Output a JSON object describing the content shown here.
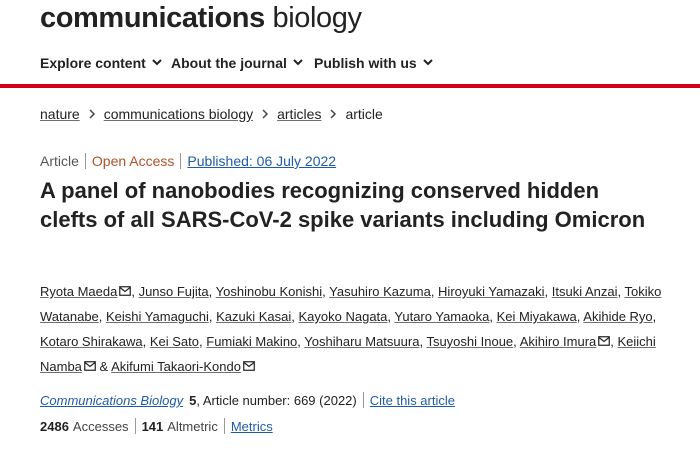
{
  "header": {
    "brand_bold": "communications",
    "brand_light": "biology"
  },
  "nav": {
    "items": [
      {
        "label": "Explore content"
      },
      {
        "label": "About the journal"
      },
      {
        "label": "Publish with us"
      }
    ],
    "accent_color": "#d0021b"
  },
  "breadcrumb": {
    "items": [
      "nature",
      "communications biology",
      "articles",
      "article"
    ]
  },
  "article": {
    "type": "Article",
    "access": "Open Access",
    "published": "Published: 06 July 2022",
    "title": "A panel of nanobodies recognizing conserved hidden clefts of all SARS-CoV-2 spike variants including Omicron",
    "authors": [
      {
        "name": "Ryota Maeda",
        "mail": true
      },
      {
        "name": "Junso Fujita",
        "mail": false
      },
      {
        "name": "Yoshinobu Konishi",
        "mail": false
      },
      {
        "name": "Yasuhiro Kazuma",
        "mail": false
      },
      {
        "name": "Hiroyuki Yamazaki",
        "mail": false
      },
      {
        "name": "Itsuki Anzai",
        "mail": false
      },
      {
        "name": "Tokiko Watanabe",
        "mail": false
      },
      {
        "name": "Keishi Yamaguchi",
        "mail": false
      },
      {
        "name": "Kazuki Kasai",
        "mail": false
      },
      {
        "name": "Kayoko Nagata",
        "mail": false
      },
      {
        "name": "Yutaro Yamaoka",
        "mail": false
      },
      {
        "name": "Kei Miyakawa",
        "mail": false
      },
      {
        "name": "Akihide Ryo",
        "mail": false
      },
      {
        "name": "Kotaro Shirakawa",
        "mail": false
      },
      {
        "name": "Kei Sato",
        "mail": false
      },
      {
        "name": "Fumiaki Makino",
        "mail": false
      },
      {
        "name": "Yoshiharu Matsuura",
        "mail": false
      },
      {
        "name": "Tsuyoshi Inoue",
        "mail": false
      },
      {
        "name": "Akihiro Imura",
        "mail": true
      },
      {
        "name": "Keiichi Namba",
        "mail": true
      },
      {
        "name": "Akifumi Takaori-Kondo",
        "mail": true
      }
    ],
    "journal": "Communications Biology",
    "volume": "5",
    "article_number": ", Article number: 669 (2022)",
    "cite_label": "Cite this article",
    "accesses_count": "2486",
    "accesses_label": "Accesses",
    "altmetric_count": "141",
    "altmetric_label": "Altmetric",
    "metrics_label": "Metrics"
  },
  "colors": {
    "link": "#1f5ca8",
    "open_access": "#b2502a",
    "text": "#222222"
  }
}
